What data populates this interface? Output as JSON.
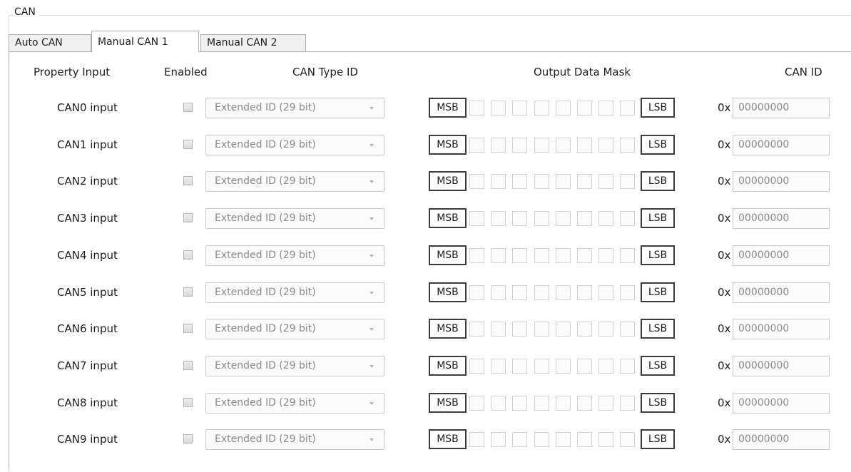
{
  "group": {
    "title": "CAN"
  },
  "tabs": [
    {
      "label": "Auto CAN",
      "selected": false
    },
    {
      "label": "Manual CAN 1",
      "selected": true
    },
    {
      "label": "Manual CAN 2",
      "selected": false
    }
  ],
  "headers": {
    "property_input": "Property Input",
    "enabled": "Enabled",
    "can_type_id": "CAN Type ID",
    "output_data_mask": "Output Data Mask",
    "can_id": "CAN ID"
  },
  "rows": [
    {
      "label": "CAN0 input",
      "enabled": false,
      "type": "Extended ID (29 bit)",
      "msb": "MSB",
      "lsb": "LSB",
      "hex_prefix": "0x",
      "can_id": "00000000"
    },
    {
      "label": "CAN1 input",
      "enabled": false,
      "type": "Extended ID (29 bit)",
      "msb": "MSB",
      "lsb": "LSB",
      "hex_prefix": "0x",
      "can_id": "00000000"
    },
    {
      "label": "CAN2 input",
      "enabled": false,
      "type": "Extended ID (29 bit)",
      "msb": "MSB",
      "lsb": "LSB",
      "hex_prefix": "0x",
      "can_id": "00000000"
    },
    {
      "label": "CAN3 input",
      "enabled": false,
      "type": "Extended ID (29 bit)",
      "msb": "MSB",
      "lsb": "LSB",
      "hex_prefix": "0x",
      "can_id": "00000000"
    },
    {
      "label": "CAN4 input",
      "enabled": false,
      "type": "Extended ID (29 bit)",
      "msb": "MSB",
      "lsb": "LSB",
      "hex_prefix": "0x",
      "can_id": "00000000"
    },
    {
      "label": "CAN5 input",
      "enabled": false,
      "type": "Extended ID (29 bit)",
      "msb": "MSB",
      "lsb": "LSB",
      "hex_prefix": "0x",
      "can_id": "00000000"
    },
    {
      "label": "CAN6 input",
      "enabled": false,
      "type": "Extended ID (29 bit)",
      "msb": "MSB",
      "lsb": "LSB",
      "hex_prefix": "0x",
      "can_id": "00000000"
    },
    {
      "label": "CAN7 input",
      "enabled": false,
      "type": "Extended ID (29 bit)",
      "msb": "MSB",
      "lsb": "LSB",
      "hex_prefix": "0x",
      "can_id": "00000000"
    },
    {
      "label": "CAN8 input",
      "enabled": false,
      "type": "Extended ID (29 bit)",
      "msb": "MSB",
      "lsb": "LSB",
      "hex_prefix": "0x",
      "can_id": "00000000"
    },
    {
      "label": "CAN9 input",
      "enabled": false,
      "type": "Extended ID (29 bit)",
      "msb": "MSB",
      "lsb": "LSB",
      "hex_prefix": "0x",
      "can_id": "00000000"
    }
  ],
  "colors": {
    "disabled_text": "#8a8a8a",
    "mask_border": "#3c3c3c",
    "control_border": "#c8c8c8"
  }
}
